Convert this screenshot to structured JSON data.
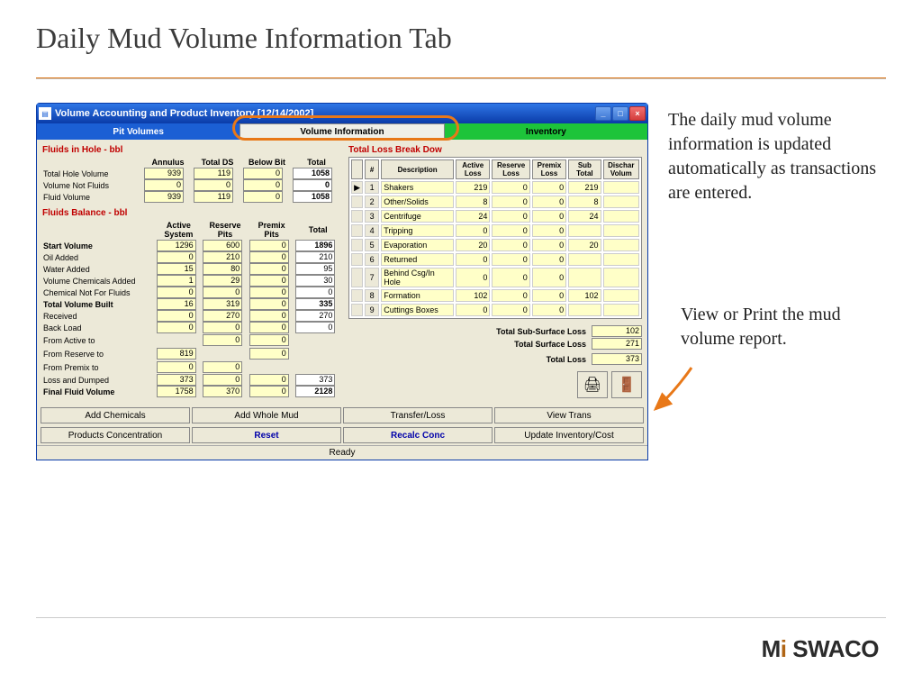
{
  "slide": {
    "title": "Daily Mud Volume Information Tab"
  },
  "window": {
    "title": "Volume Accounting and Product Inventory [12/14/2002]",
    "tabs": {
      "pit": "Pit Volumes",
      "vol": "Volume Information",
      "inv": "Inventory"
    },
    "status": "Ready"
  },
  "fluids_in_hole": {
    "heading": "Fluids in Hole - bbl",
    "cols": {
      "annulus": "Annulus",
      "totalds": "Total DS",
      "belowbit": "Below Bit",
      "total": "Total"
    },
    "rows": [
      {
        "label": "Total Hole Volume",
        "a": "939",
        "d": "119",
        "b": "0",
        "t": "1058"
      },
      {
        "label": "Volume Not Fluids",
        "a": "0",
        "d": "0",
        "b": "0",
        "t": "0"
      },
      {
        "label": "Fluid Volume",
        "a": "939",
        "d": "119",
        "b": "0",
        "t": "1058"
      }
    ]
  },
  "fluids_balance": {
    "heading": "Fluids Balance - bbl",
    "cols": {
      "as": "Active System",
      "rp": "Reserve Pits",
      "pp": "Premix Pits",
      "total": "Total"
    },
    "rows": [
      {
        "label": "Start Volume",
        "bold": true,
        "a": "1296",
        "r": "600",
        "p": "0",
        "t": "1896"
      },
      {
        "label": "Oil Added",
        "a": "0",
        "r": "210",
        "p": "0",
        "t": "210"
      },
      {
        "label": "Water Added",
        "a": "15",
        "r": "80",
        "p": "0",
        "t": "95"
      },
      {
        "label": "Volume Chemicals Added",
        "a": "1",
        "r": "29",
        "p": "0",
        "t": "30"
      },
      {
        "label": "Chemical Not For  Fluids",
        "a": "0",
        "r": "0",
        "p": "0",
        "t": "0"
      },
      {
        "label": "Total Volume Built",
        "bold": true,
        "a": "16",
        "r": "319",
        "p": "0",
        "t": "335"
      },
      {
        "label": "Received",
        "a": "0",
        "r": "270",
        "p": "0",
        "t": "270"
      },
      {
        "label": "Back Load",
        "a": "0",
        "r": "0",
        "p": "0",
        "t": "0"
      },
      {
        "label": "From Active to",
        "a": "",
        "r": "0",
        "p": "0",
        "t": ""
      },
      {
        "label": "From Reserve to",
        "a": "819",
        "r": "",
        "p": "0",
        "t": ""
      },
      {
        "label": "From Premix to",
        "a": "0",
        "r": "0",
        "p": "",
        "t": ""
      },
      {
        "label": "Loss and Dumped",
        "a": "373",
        "r": "0",
        "p": "0",
        "t": "373"
      },
      {
        "label": "Final Fluid Volume",
        "bold": true,
        "a": "1758",
        "r": "370",
        "p": "0",
        "t": "2128"
      }
    ]
  },
  "breakdown": {
    "heading": "Total Loss Break Dow",
    "cols": {
      "n": "#",
      "desc": "Description",
      "al": "Active Loss",
      "rl": "Reserve Loss",
      "pl": "Premix Loss",
      "st": "Sub Total",
      "dv": "Dischar Volum"
    },
    "rows": [
      {
        "n": "1",
        "desc": "Shakers",
        "al": "219",
        "rl": "0",
        "pl": "0",
        "st": "219"
      },
      {
        "n": "2",
        "desc": "Other/Solids",
        "al": "8",
        "rl": "0",
        "pl": "0",
        "st": "8"
      },
      {
        "n": "3",
        "desc": "Centrifuge",
        "al": "24",
        "rl": "0",
        "pl": "0",
        "st": "24"
      },
      {
        "n": "4",
        "desc": "Tripping",
        "al": "0",
        "rl": "0",
        "pl": "0",
        "st": ""
      },
      {
        "n": "5",
        "desc": "Evaporation",
        "al": "20",
        "rl": "0",
        "pl": "0",
        "st": "20"
      },
      {
        "n": "6",
        "desc": "Returned",
        "al": "0",
        "rl": "0",
        "pl": "0",
        "st": ""
      },
      {
        "n": "7",
        "desc": "Behind Csg/In Hole",
        "al": "0",
        "rl": "0",
        "pl": "0",
        "st": ""
      },
      {
        "n": "8",
        "desc": "Formation",
        "al": "102",
        "rl": "0",
        "pl": "0",
        "st": "102"
      },
      {
        "n": "9",
        "desc": "Cuttings Boxes",
        "al": "0",
        "rl": "0",
        "pl": "0",
        "st": ""
      }
    ],
    "summary": {
      "ssl_lbl": "Total Sub-Surface Loss",
      "ssl": "102",
      "sl_lbl": "Total Surface Loss",
      "sl": "271",
      "tl_lbl": "Total Loss",
      "tl": "373"
    }
  },
  "buttons": {
    "row1": [
      "Add Chemicals",
      "Add Whole Mud",
      "Transfer/Loss",
      "View Trans"
    ],
    "row2": [
      "Products Concentration",
      "Reset",
      "Recalc Conc",
      "Update Inventory/Cost"
    ]
  },
  "annotations": {
    "a1": "The daily mud volume information is updated automatically as transactions are entered.",
    "a2": "View or Print the mud volume report."
  },
  "logo": {
    "p1": "M",
    "i": "i",
    "p2": "SWACO"
  }
}
